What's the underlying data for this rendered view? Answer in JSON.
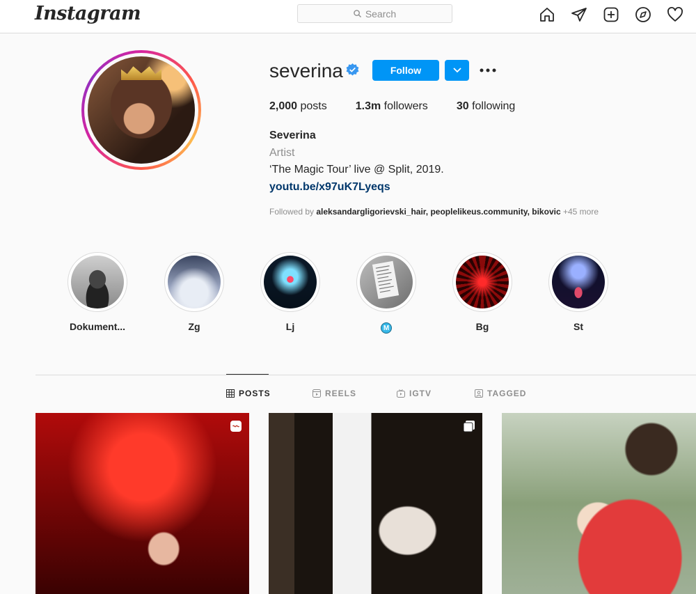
{
  "nav": {
    "logo": "Instagram",
    "search_placeholder": "Search",
    "icons": [
      "home-icon",
      "direct-icon",
      "new-post-icon",
      "explore-icon",
      "activity-heart-icon"
    ]
  },
  "profile": {
    "username": "severina",
    "verified": true,
    "follow_label": "Follow",
    "stats": {
      "posts_count": "2,000",
      "posts_label": "posts",
      "followers_count": "1.3m",
      "followers_label": "followers",
      "following_count": "30",
      "following_label": "following"
    },
    "full_name": "Severina",
    "category": "Artist",
    "bio": "‘The Magic Tour’ live @ Split, 2019.",
    "link": "youtu.be/x97uK7Lyeqs",
    "followed_by": {
      "prefix": "Followed by",
      "users": "aleksandargligorievski_hair, peoplelikeus.community, bikovic",
      "more": "+45 more"
    }
  },
  "highlights": [
    {
      "label": "Dokument..."
    },
    {
      "label": "Zg"
    },
    {
      "label": "Lj"
    },
    {
      "label": "M"
    },
    {
      "label": "Bg"
    },
    {
      "label": "St"
    }
  ],
  "tabs": [
    {
      "label": "POSTS",
      "active": true
    },
    {
      "label": "REELS",
      "active": false
    },
    {
      "label": "IGTV",
      "active": false
    },
    {
      "label": "TAGGED",
      "active": false
    }
  ],
  "colors": {
    "accent": "#0095f6",
    "link": "#00376b",
    "muted": "#8e8e8e"
  }
}
